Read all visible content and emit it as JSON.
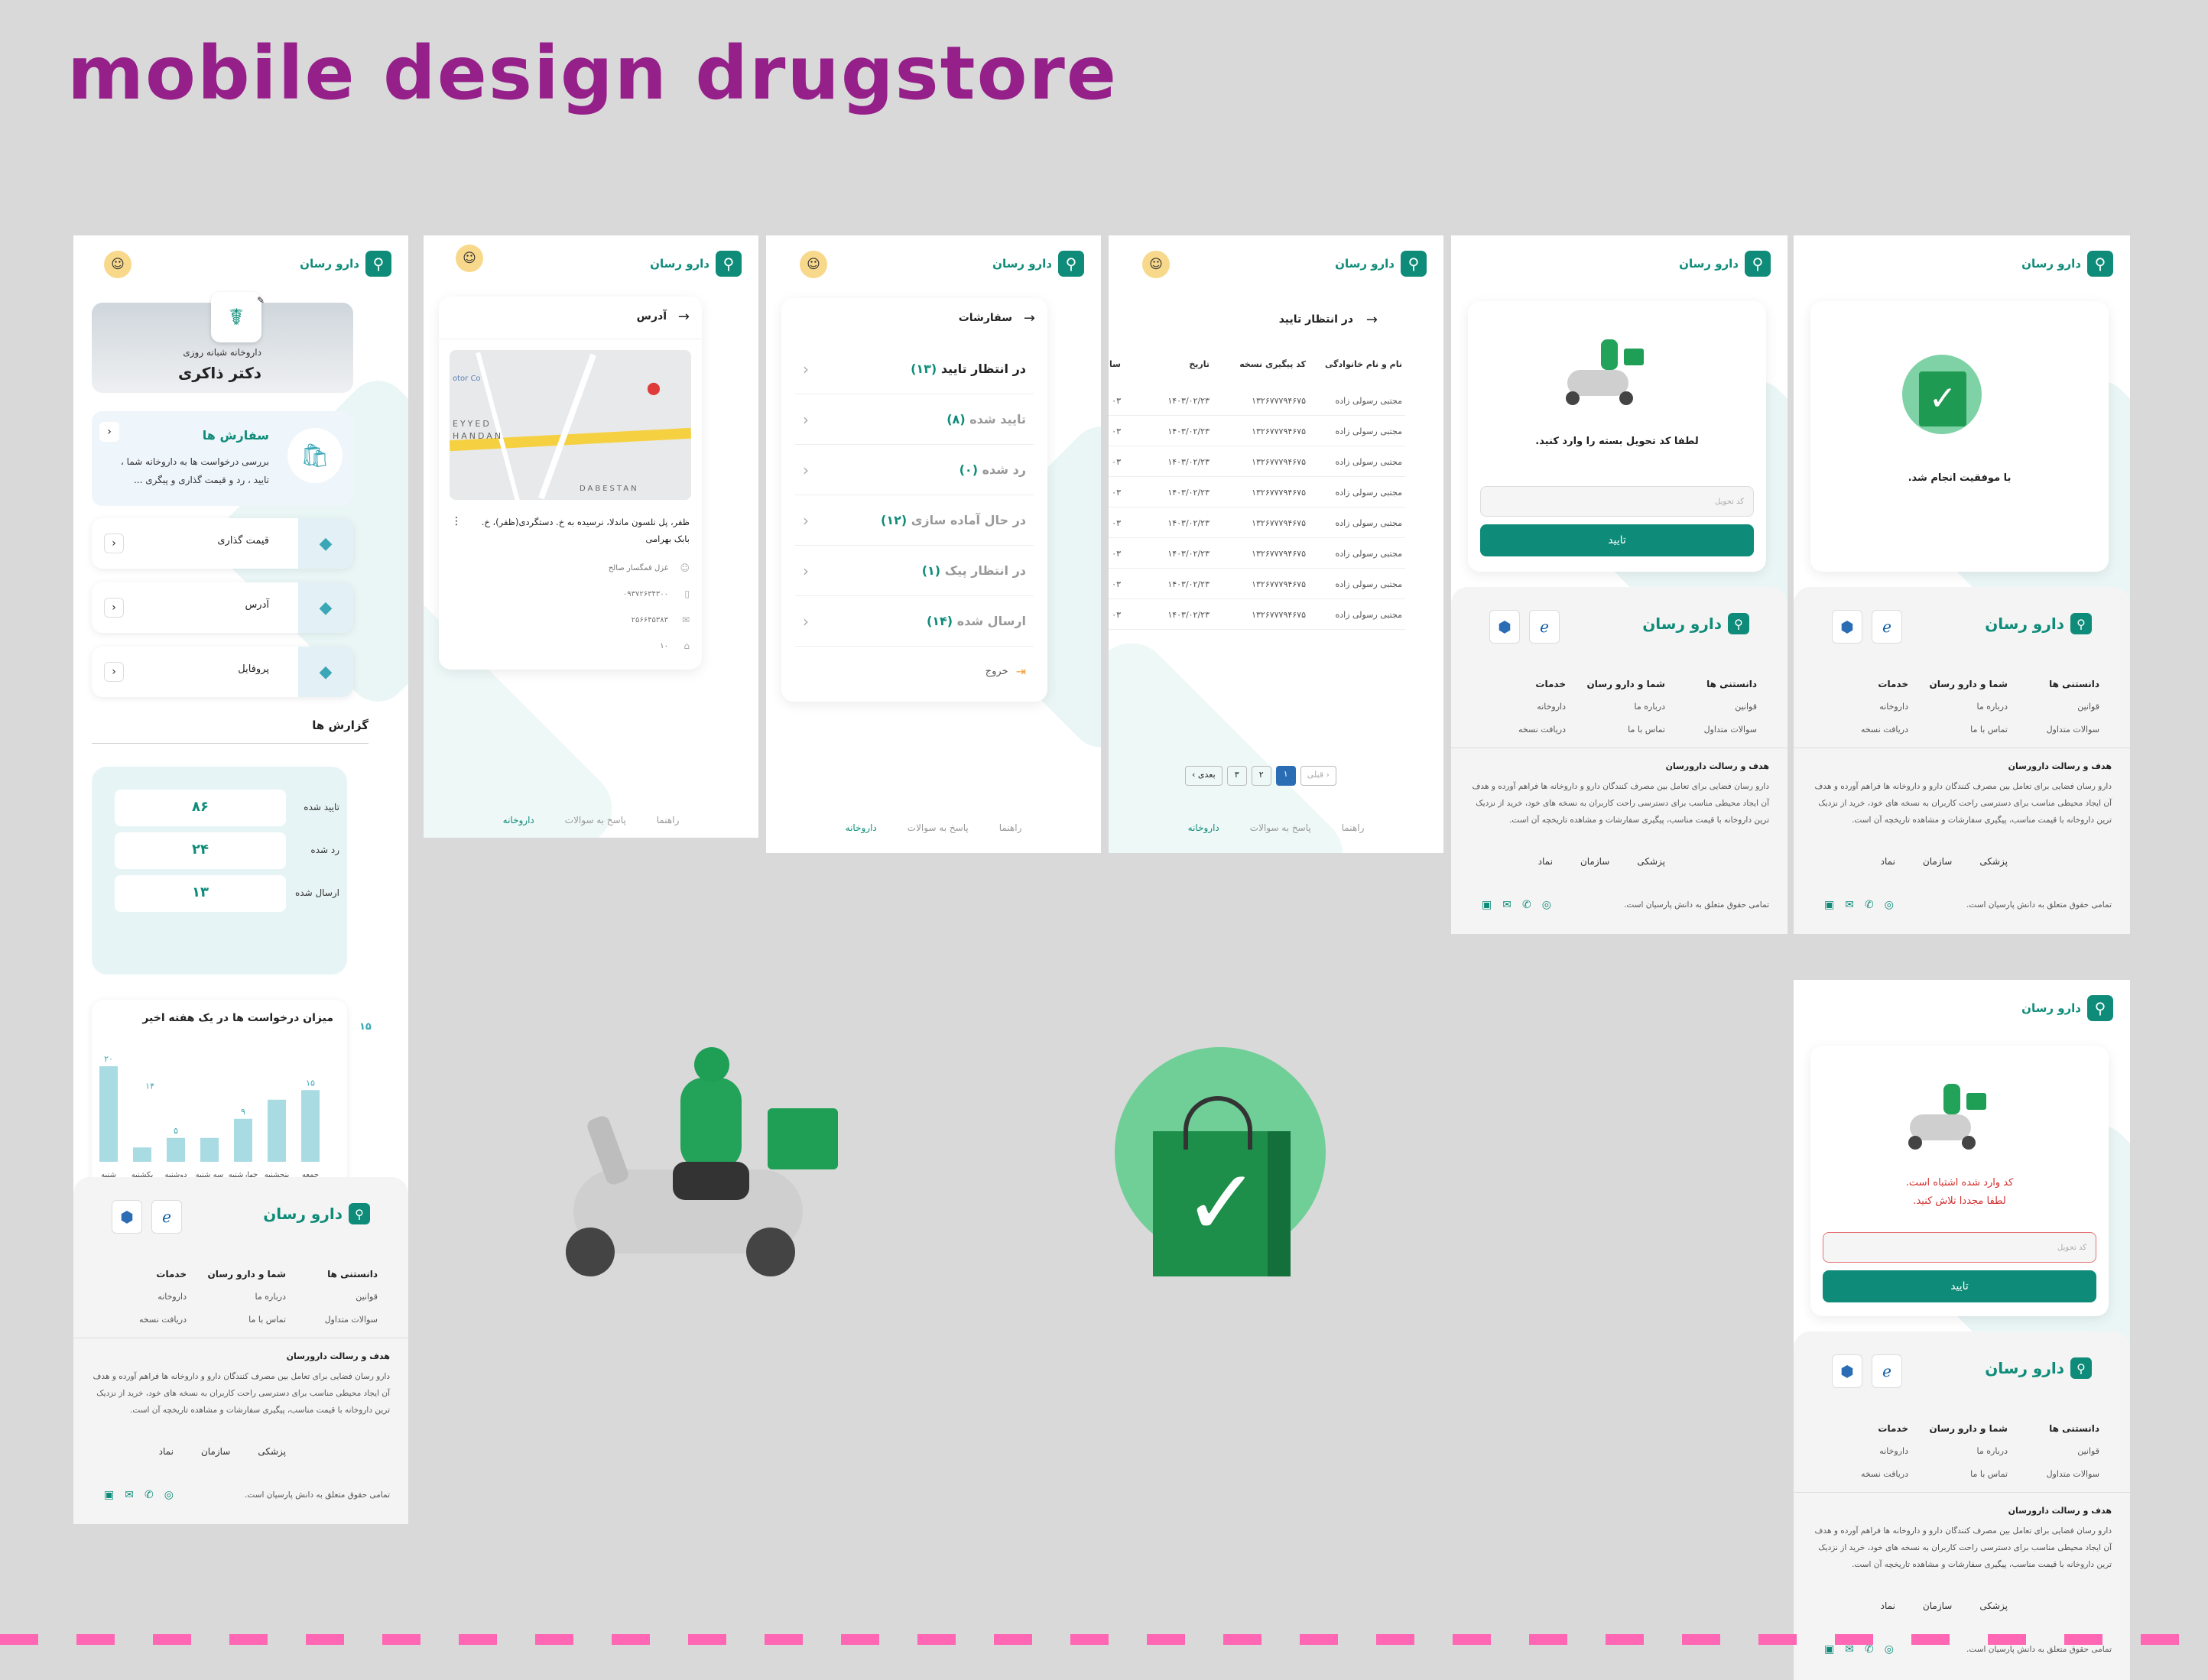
{
  "page_title": "mobile design drugstore",
  "brand": {
    "name": "دارو رسان",
    "color": "#0e8c79",
    "title_color": "#96208a"
  },
  "icons": {
    "logo": "magnifier-icon",
    "avatar": "user-icon",
    "back": "arrow-right-icon",
    "chevron": "chevron-left-icon"
  },
  "s1": {
    "pharmacy_type": "داروخانه شبانه روزی",
    "pharmacy_name": "دکتر ذاکری",
    "orders_title": "سفارش ها",
    "orders_desc": "بررسی درخواست ها به داروخانه شما ،\nتایید ، رد و قیمت گذاری و پیگری ...",
    "menu": [
      {
        "label": "قیمت گذاری"
      },
      {
        "label": "آدرس"
      },
      {
        "label": "پروفایل"
      }
    ],
    "reports_title": "گزارش ها",
    "stats": [
      {
        "label": "تایید شده",
        "value": "۸۶"
      },
      {
        "label": "رد شده",
        "value": "۲۴"
      },
      {
        "label": "ارسال شده",
        "value": "۱۳"
      }
    ],
    "chart_title": "میزان درخواست ها در یک هفته اخیر"
  },
  "chart_data": {
    "type": "bar",
    "title": "میزان درخواست ها در یک هفته اخیر",
    "categories": [
      "جمعه",
      "پنجشنبه",
      "چهارشنبه",
      "سه شنبه",
      "دوشنبه",
      "یکشنبه",
      "شنبه"
    ],
    "values": [
      15,
      13,
      9,
      5,
      5,
      3,
      20
    ],
    "value_labels": [
      "۱۵",
      "",
      "۹",
      "",
      "۵",
      "",
      "۲۰"
    ],
    "extra_label": "۱۴",
    "ylim": [
      0,
      24
    ]
  },
  "s2": {
    "title": "آدرس",
    "map_labels": [
      "EYYED",
      "HANDAN",
      "DABESTAN",
      "otor Co"
    ],
    "address": "ظفر، پل نلسون ماندلا، نرسیده به خ. دستگردی(ظفر)، خ.\nبابک بهرامی",
    "owner": "غزل قمگسار صالح",
    "mobile": "۰۹۳۷۲۶۳۴۳۰۰",
    "phone": "۲۵۶۶۴۵۳۸۳",
    "plaque": "۱۰",
    "nav": [
      "راهنما",
      "پاسخ به سوالات",
      "داروخانه"
    ]
  },
  "s3": {
    "title": "سفارشات",
    "items": [
      {
        "label": "در انتظار تایید",
        "count": "(۱۳)"
      },
      {
        "label": "تایید شده",
        "count": "(۸)"
      },
      {
        "label": "رد شده",
        "count": "(۰)"
      },
      {
        "label": "در حال آماده سازی",
        "count": "(۱۲)"
      },
      {
        "label": "در انتظار پیک",
        "count": "(۱)"
      },
      {
        "label": "ارسال شده",
        "count": "(۱۴)"
      }
    ],
    "logout": "خروج",
    "nav": [
      "راهنما",
      "پاسخ به سوالات",
      "داروخانه"
    ]
  },
  "s4": {
    "title": "در انتظار تایید",
    "cols": [
      "نام و نام خانوادگی",
      "کد پیگیری نسخه",
      "تاریخ",
      "سا"
    ],
    "row": {
      "name": "مجتبی رسولی زاده",
      "code": "۱۳۲۶۷۷۷۹۴۶۷۵",
      "date": "۱۴۰۳/۰۲/۲۳",
      "time": "۰۳"
    },
    "row_count": 8,
    "pager": {
      "prev": "قبلی",
      "next": "بعدی",
      "pages": [
        "۱",
        "۲",
        "۳"
      ]
    },
    "nav": [
      "راهنما",
      "پاسخ به سوالات",
      "داروخانه"
    ]
  },
  "s5": {
    "msg": "لطفا کد تحویل بسته را وارد کنید.",
    "placeholder": "کد تحویل",
    "button": "تایید"
  },
  "s6": {
    "msg": "با موفقیت انجام شد."
  },
  "s7": {
    "msg1": "کد وارد شده اشتباه است.",
    "msg2": "لطفا مجددا تلاش کنید.",
    "placeholder": "کد تحویل",
    "button": "تایید"
  },
  "footer": {
    "col1": {
      "title": "دانستنی ها",
      "items": [
        "قوانین",
        "سوالات متداول"
      ]
    },
    "col2": {
      "title": "شما و دارو رسان",
      "items": [
        "درباره ما",
        "تماس با ما"
      ]
    },
    "col3": {
      "title": "خدمات",
      "items": [
        "داروخانه",
        "دریافت نسخه"
      ]
    },
    "mission_title": "هدف و رسالت دارورسان",
    "mission": "دارو رسان فضایی برای تعامل بین مصرف کنندگان دارو و داروخانه ها فراهم آورده و هدف آن ایجاد محیطی مناسب برای دسترسی راحت کاربران به نسخه های خود، خرید از نزدیک ترین داروخانه با قیمت مناسب، پیگیری سفارشات و مشاهده تاریخچه آن است.",
    "copyright": "تمامی حقوق متعلق به دانش پارسیان است.",
    "badges": [
      "e-namad",
      "samandehi"
    ],
    "mini_logos": [
      "نماد",
      "سازمان",
      "پزشکی"
    ],
    "social": [
      "instagram-icon",
      "whatsapp-icon",
      "mail-icon",
      "linkedin-icon"
    ]
  }
}
